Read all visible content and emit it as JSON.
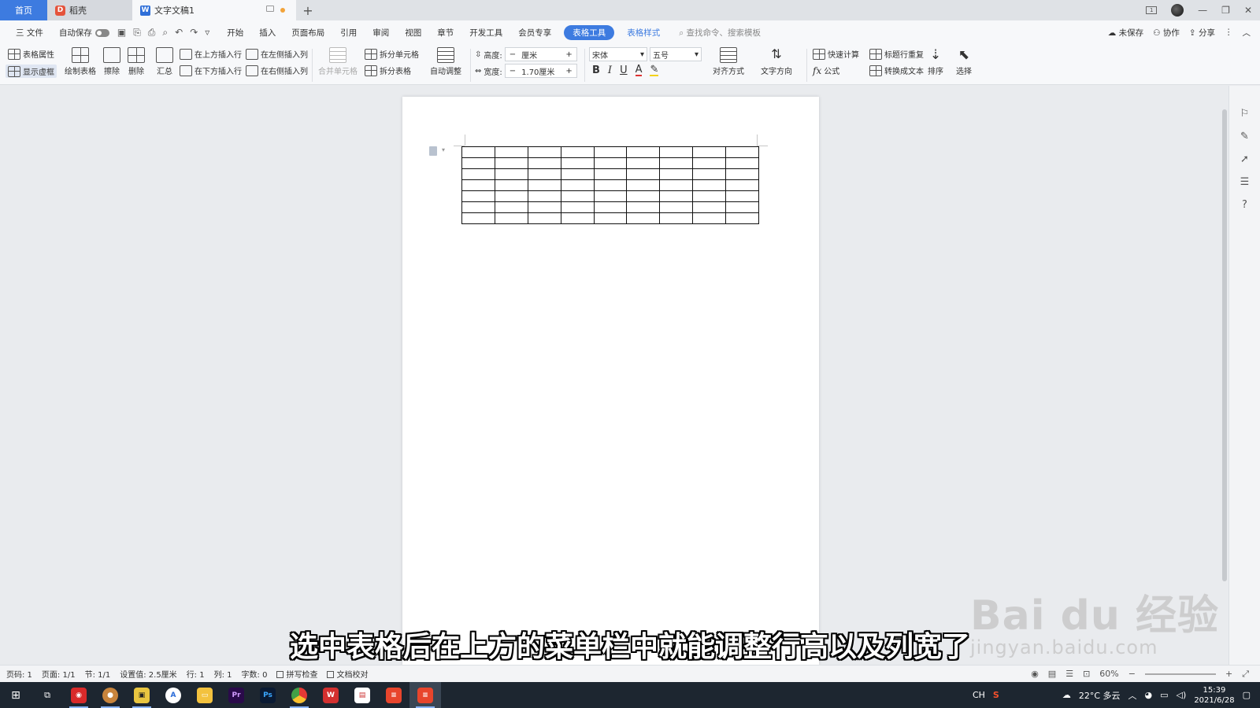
{
  "titlebar": {
    "home_tab": "首页",
    "tabs": [
      {
        "label": "稻壳",
        "logo": "D"
      },
      {
        "label": "文字文稿1",
        "logo": "W"
      }
    ],
    "new_tab": "+",
    "window_controls": [
      "—",
      "❐",
      "✕"
    ]
  },
  "menubar": {
    "file": "三 文件",
    "autosave": "自动保存",
    "items": [
      "开始",
      "插入",
      "页面布局",
      "引用",
      "审阅",
      "视图",
      "章节",
      "开发工具",
      "会员专享"
    ],
    "active_tab": "表格工具",
    "secondary_tab": "表格样式",
    "search_placeholder": "查找命令、搜索模板",
    "right": [
      "未保存",
      "协作",
      "分享"
    ]
  },
  "ribbon": {
    "table_props": "表格属性",
    "show_gridlines": "显示虚框",
    "draw_table": "绘制表格",
    "erase": "擦除",
    "delete": "删除",
    "summary": "汇总",
    "insert_above": "在上方插入行",
    "insert_below": "在下方插入行",
    "insert_left": "在左侧插入列",
    "insert_right": "在右侧插入列",
    "merge_cells": "合并单元格",
    "split_cells": "拆分单元格",
    "split_table": "拆分表格",
    "auto_fit": "自动调整",
    "height_label": "高度:",
    "height_value": "厘米",
    "width_label": "宽度:",
    "width_value": "1.70厘米",
    "font_name": "宋体",
    "font_size": "五号",
    "align": "对齐方式",
    "text_dir": "文字方向",
    "quick_calc": "快速计算",
    "repeat_header": "标题行重复",
    "formula": "公式",
    "to_text": "转换成文本",
    "sort": "排序",
    "select": "选择"
  },
  "document": {
    "table_rows": 7,
    "table_cols": 9
  },
  "subtitle": "选中表格后在上方的菜单栏中就能调整行高以及列宽了",
  "watermark": {
    "main": "Bai du 经验",
    "sub": "jingyan.baidu.com"
  },
  "statusbar": {
    "page_num": "页码: 1",
    "pages": "页面: 1/1",
    "section": "节: 1/1",
    "setting": "设置值: 2.5厘米",
    "row": "行: 1",
    "col": "列: 1",
    "words": "字数: 0",
    "spell": "拼写检查",
    "proof": "文档校对",
    "zoom": "60%"
  },
  "taskbar": {
    "weather": "22°C 多云",
    "time": "15:39",
    "date": "2021/6/28",
    "ime": "CH"
  }
}
